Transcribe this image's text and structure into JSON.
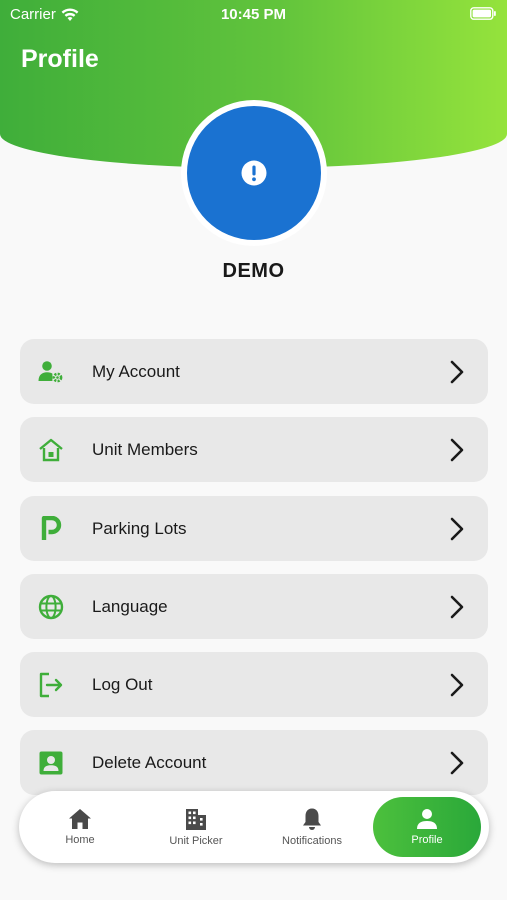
{
  "status": {
    "carrier": "Carrier",
    "time": "10:45 PM"
  },
  "header": {
    "title": "Profile"
  },
  "profile": {
    "name": "DEMO"
  },
  "menu": [
    {
      "label": "My Account",
      "icon": "user-gear-icon"
    },
    {
      "label": "Unit Members",
      "icon": "home-icon"
    },
    {
      "label": "Parking Lots",
      "icon": "parking-icon"
    },
    {
      "label": "Language",
      "icon": "globe-icon"
    },
    {
      "label": "Log Out",
      "icon": "logout-icon"
    },
    {
      "label": "Delete Account",
      "icon": "account-box-icon"
    }
  ],
  "tabs": [
    {
      "label": "Home",
      "icon": "home-icon"
    },
    {
      "label": "Unit Picker",
      "icon": "building-icon"
    },
    {
      "label": "Notifications",
      "icon": "bell-icon"
    },
    {
      "label": "Profile",
      "icon": "person-icon",
      "active": true
    }
  ],
  "colors": {
    "accent": "#3fae3a",
    "avatar": "#1a72d1",
    "card": "#e8e8e8"
  }
}
